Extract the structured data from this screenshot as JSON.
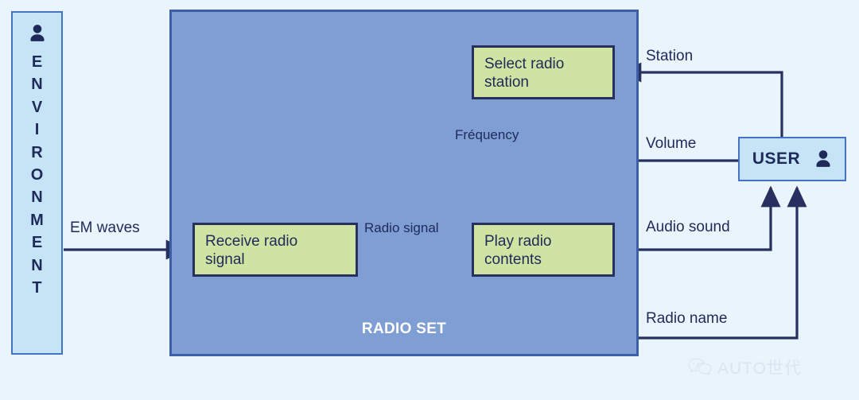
{
  "diagram": {
    "title": "Radio set context / functional flow diagram",
    "colors": {
      "page_background": "#eaf4fc",
      "system_fill": "#7e9ed4",
      "system_border": "#3c5fa5",
      "process_fill": "#cfe3a3",
      "process_border": "#27305e",
      "actor_fill": "#c5e5f7",
      "actor_border": "#4472c4",
      "line": "#27305e",
      "text": "#1f2a5a",
      "system_title_text": "#ffffff"
    }
  },
  "environment": {
    "label": "ENVIRONMENT",
    "letters": [
      "E",
      "N",
      "V",
      "I",
      "R",
      "O",
      "N",
      "M",
      "E",
      "N",
      "T"
    ],
    "icon": "person-icon"
  },
  "system": {
    "title": "RADIO SET"
  },
  "processes": [
    {
      "id": "receive",
      "label_line1": "Receive radio",
      "label_line2": "signal"
    },
    {
      "id": "select",
      "label_line1": "Select radio",
      "label_line2": "station"
    },
    {
      "id": "play",
      "label_line1": "Play radio",
      "label_line2": "contents"
    }
  ],
  "actor": {
    "label": "USER",
    "icon": "person-icon"
  },
  "flows": [
    {
      "id": "em-waves",
      "label": "EM waves",
      "from": "environment",
      "to": "receive"
    },
    {
      "id": "radio-signal",
      "label": "Radio signal",
      "from": "receive",
      "to": "play"
    },
    {
      "id": "frequency",
      "label": "Fréquency",
      "from": "select",
      "to": "play"
    },
    {
      "id": "station",
      "label": "Station",
      "from": "user",
      "to": "select"
    },
    {
      "id": "volume",
      "label": "Volume",
      "from": "user",
      "to": "play"
    },
    {
      "id": "audio-sound",
      "label": "Audio sound",
      "from": "play",
      "to": "user"
    },
    {
      "id": "radio-name",
      "label": "Radio name",
      "from": "play",
      "to": "user"
    }
  ],
  "watermark": {
    "text": "AUTO世代",
    "icon": "wechat-icon"
  }
}
